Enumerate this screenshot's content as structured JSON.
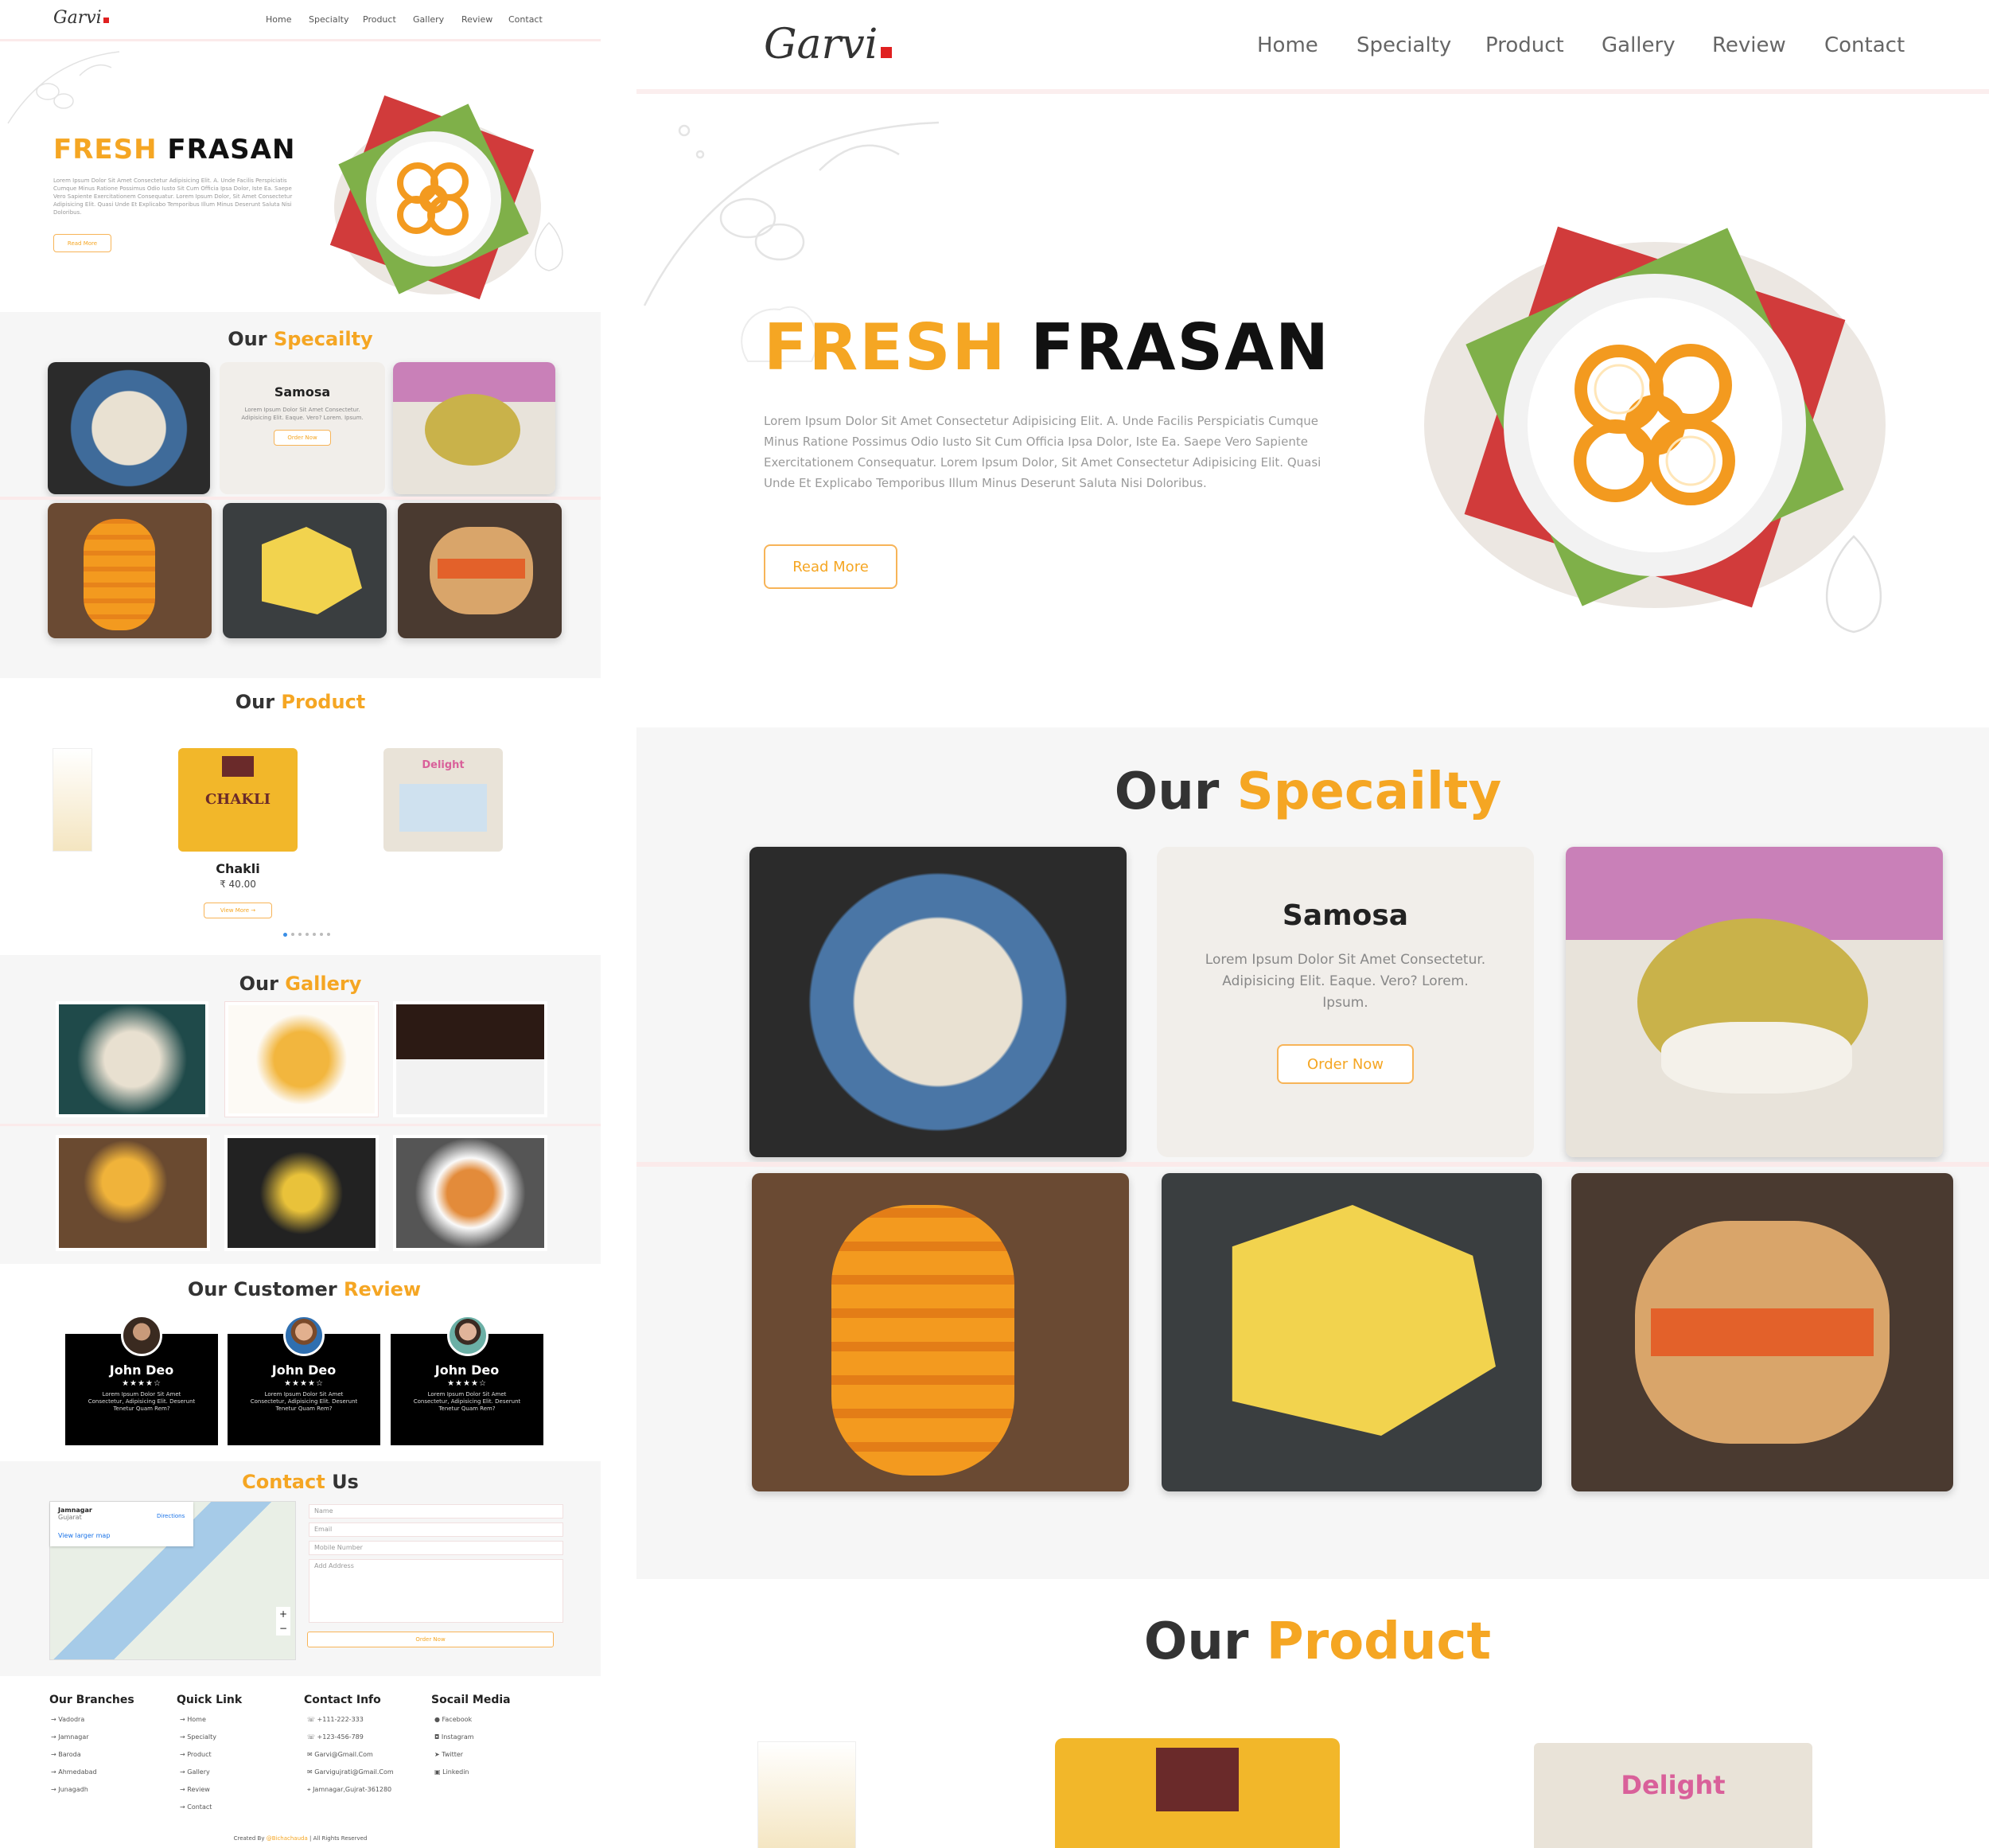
{
  "brand": {
    "name": "Garvi",
    "accent": "#f5a623",
    "logo_dot": "#e02020"
  },
  "nav": [
    "Home",
    "Specialty",
    "Product",
    "Gallery",
    "Review",
    "Contact"
  ],
  "hero": {
    "title_highlight": "FRESH",
    "title_rest": "FRASAN",
    "lorem": "Lorem Ipsum Dolor Sit Amet Consectetur Adipisicing Elit. A. Unde Facilis Perspiciatis Cumque Minus Ratione Possimus Odio Iusto Sit Cum Officia Ipsa Dolor, Iste Ea. Saepe Vero Sapiente Exercitationem Consequatur. Lorem Ipsum Dolor, Sit Amet Consectetur Adipisicing Elit. Quasi Unde Et Explicabo Temporibus Illum Minus Deserunt Saluta Nisi Doloribus.",
    "read_more": "Read More"
  },
  "specialty": {
    "title_plain": "Our",
    "title_highlight": "Specailty",
    "card_title": "Samosa",
    "card_text": "Lorem Ipsum Dolor Sit Amet Consectetur. Adipisicing Elit. Eaque. Vero? Lorem. Ipsum.",
    "order_label": "Order Now"
  },
  "product": {
    "title_plain": "Our",
    "title_highlight": "Product",
    "featured_name": "Chakli",
    "featured_price": "₹ 40.00",
    "view_more": "View More →",
    "pack_labels": [
      "CHAKLI",
      "Delight"
    ]
  },
  "gallery": {
    "title_plain": "Our",
    "title_highlight": "Gallery"
  },
  "review": {
    "title_plain": "Our Customer",
    "title_highlight": "Review",
    "cards": [
      {
        "name": "John Deo",
        "stars": "★★★★☆",
        "text": "Lorem Ipsum Dolor Sit Amet Consectetur, Adipisicing Elit. Deserunt Tenetur Quam Rem?"
      },
      {
        "name": "John Deo",
        "stars": "★★★★☆",
        "text": "Lorem Ipsum Dolor Sit Amet Consectetur, Adipisicing Elit. Deserunt Tenetur Quam Rem?"
      },
      {
        "name": "John Deo",
        "stars": "★★★★☆",
        "text": "Lorem Ipsum Dolor Sit Amet Consectetur, Adipisicing Elit. Deserunt Tenetur Quam Rem?"
      }
    ]
  },
  "contact": {
    "title_highlight": "Contact",
    "title_plain": "Us",
    "map_place": "Jamnagar",
    "map_sub": "Gujarat",
    "map_directions": "Directions",
    "map_larger": "View larger map",
    "fields": [
      "Name",
      "Email",
      "Mobile Number",
      "Add Address"
    ],
    "submit": "Order Now"
  },
  "footer": {
    "branches_title": "Our Branches",
    "branches": [
      "Vadodra",
      "Jamnagar",
      "Baroda",
      "Ahmedabad",
      "Junagadh"
    ],
    "quick_title": "Quick Link",
    "quick": [
      "Home",
      "Specialty",
      "Product",
      "Gallery",
      "Review",
      "Contact"
    ],
    "info_title": "Contact Info",
    "info": [
      "+111-222-333",
      "+123-456-789",
      "Garvi@Gmail.Com",
      "Garvigujrati@Gmail.Com",
      "Jamnagar,Gujrat-361280"
    ],
    "social_title": "Socail Media",
    "social": [
      "Facebook",
      "Instagram",
      "Twitter",
      "Linkedin"
    ],
    "credit_prefix": "Created By",
    "credit_name": "@Bichachauda",
    "credit_suffix": "| All Rights Reserved"
  }
}
